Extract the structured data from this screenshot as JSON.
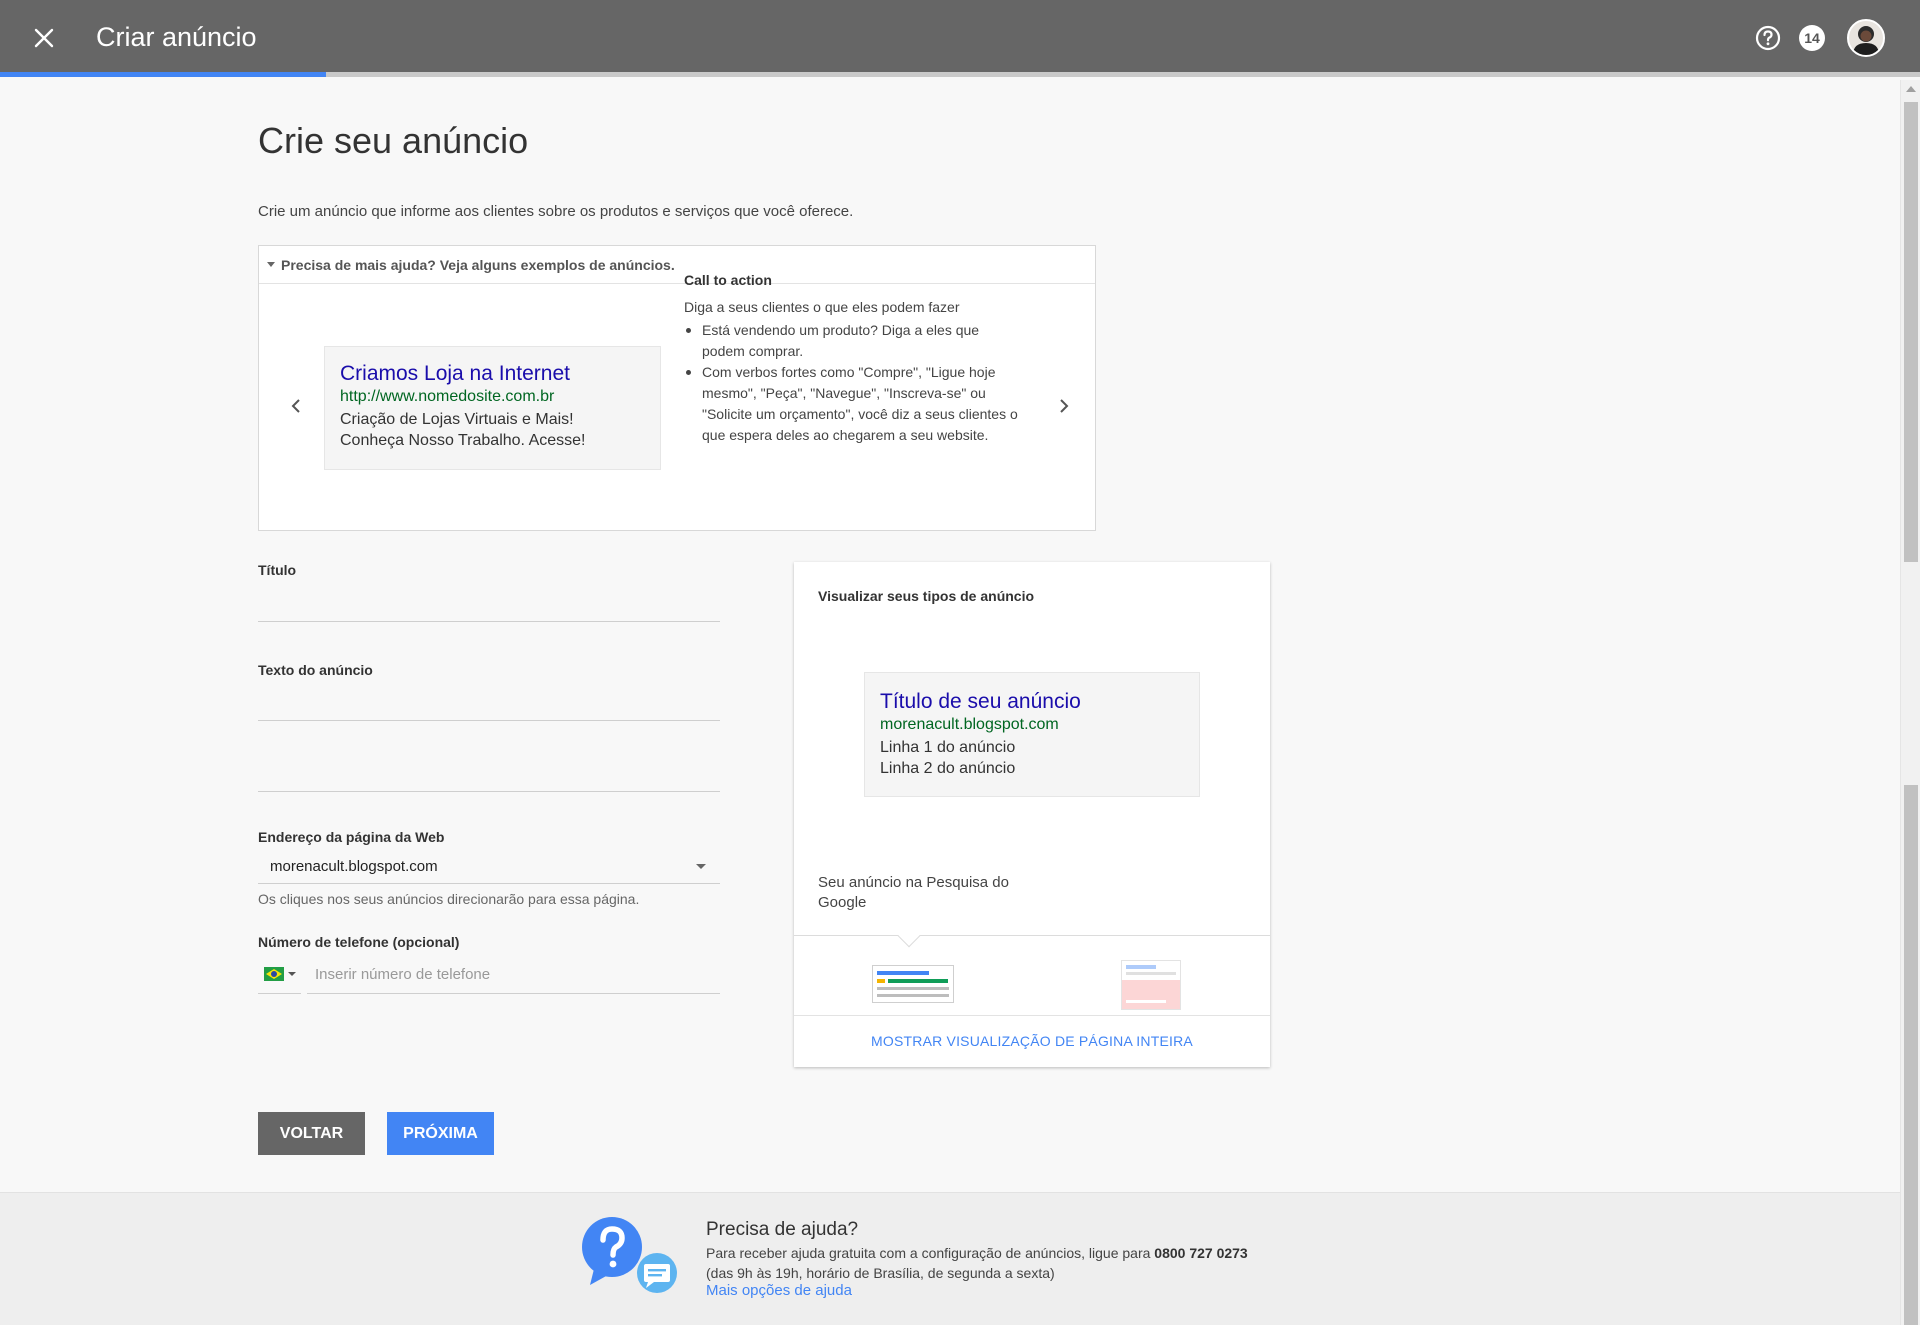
{
  "header": {
    "title": "Criar anúncio",
    "notification_count": "14",
    "progress_percent": 17
  },
  "page": {
    "title": "Crie seu anúncio",
    "subtitle": "Crie um anúncio que informe aos clientes sobre os produtos e serviços que você oferece."
  },
  "examples": {
    "toggle_label": "Precisa de mais ajuda? Veja alguns exemplos de anúncios.",
    "sample_ad": {
      "title": "Criamos Loja na Internet",
      "url": "http://www.nomedosite.com.br",
      "line1": "Criação de Lojas Virtuais e Mais!",
      "line2": "Conheça Nosso Trabalho. Acesse!"
    },
    "cta": {
      "title": "Call to action",
      "intro": "Diga a seus clientes o que eles podem fazer",
      "bullets": [
        "Está vendendo um produto? Diga a eles que podem comprar.",
        "Com verbos fortes como \"Compre\", \"Ligue hoje mesmo\", \"Peça\", \"Navegue\", \"Inscreva-se\" ou \"Solicite um orçamento\", você diz a seus clientes o que espera deles ao chegarem a seu website."
      ]
    }
  },
  "form": {
    "title_label": "Título",
    "title_value": "",
    "ad_text_label": "Texto do anúncio",
    "ad_text_line1": "",
    "ad_text_line2": "",
    "url_label": "Endereço da página da Web",
    "url_value": "morenacult.blogspot.com",
    "url_help": "Os cliques nos seus anúncios direcionarão para essa página.",
    "phone_label": "Número de telefone (opcional)",
    "phone_placeholder": "Inserir número de telefone",
    "phone_value": ""
  },
  "preview": {
    "title": "Visualizar seus tipos de anúncio",
    "ad": {
      "title": "Título de seu anúncio",
      "url": "morenacult.blogspot.com",
      "line1": "Linha 1 do anúncio",
      "line2": "Linha 2 do anúncio"
    },
    "caption": "Seu anúncio na Pesquisa do Google",
    "full_page_link": "MOSTRAR VISUALIZAÇÃO DE PÁGINA INTEIRA"
  },
  "buttons": {
    "back": "VOLTAR",
    "next": "PRÓXIMA"
  },
  "footer": {
    "title": "Precisa de ajuda?",
    "line1_prefix": "Para receber ajuda gratuita com a configuração de anúncios, ligue para ",
    "phone": "0800 727 0273",
    "line2": "(das 9h às 19h, horário de Brasília, de segunda a sexta)",
    "link": "Mais opções de ajuda"
  },
  "colors": {
    "header_bg": "#666666",
    "accent": "#4285f4",
    "ad_title": "#1a0dab",
    "ad_url": "#006621"
  }
}
